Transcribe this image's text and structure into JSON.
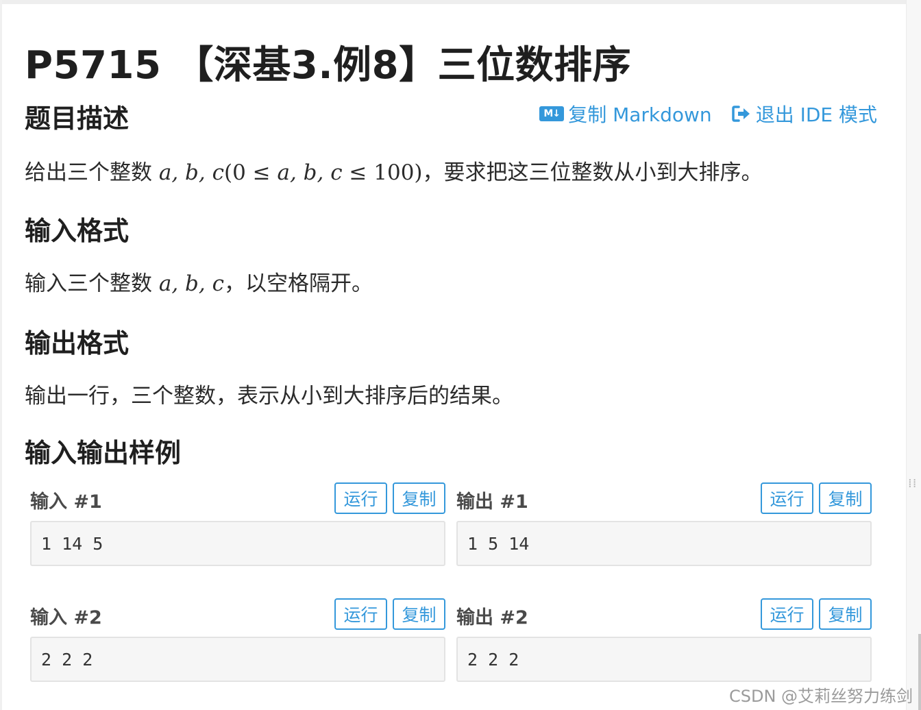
{
  "problem": {
    "title": "P5715 【深基3.例8】三位数排序"
  },
  "toolbar": {
    "copy_markdown_label": "复制 Markdown",
    "exit_ide_label": "退出 IDE 模式",
    "md_icon_text": "M↓"
  },
  "sections": {
    "description_heading": "题目描述",
    "description": {
      "prefix": "给出三个整数 ",
      "vars": "a, b, c",
      "open": "(0 ≤ ",
      "vars2": "a, b, c",
      "close": " ≤ 100)",
      "suffix": "，要求把这三位整数从小到大排序。"
    },
    "input_heading": "输入格式",
    "input": {
      "prefix": "输入三个整数 ",
      "vars": "a, b, c",
      "suffix": "，以空格隔开。"
    },
    "output_heading": "输出格式",
    "output_text": "输出一行，三个整数，表示从小到大排序后的结果。",
    "samples_heading": "输入输出样例"
  },
  "samples": [
    {
      "input_label": "输入 #1",
      "output_label": "输出 #1",
      "input": "1 14 5",
      "output": "1 5 14"
    },
    {
      "input_label": "输入 #2",
      "output_label": "输出 #2",
      "input": "2 2 2",
      "output": "2 2 2"
    }
  ],
  "buttons": {
    "run": "运行",
    "copy": "复制"
  },
  "watermark": "CSDN @艾莉丝努力练剑",
  "colors": {
    "accent": "#3498db",
    "text": "#262626",
    "code_bg": "#f6f6f6"
  }
}
